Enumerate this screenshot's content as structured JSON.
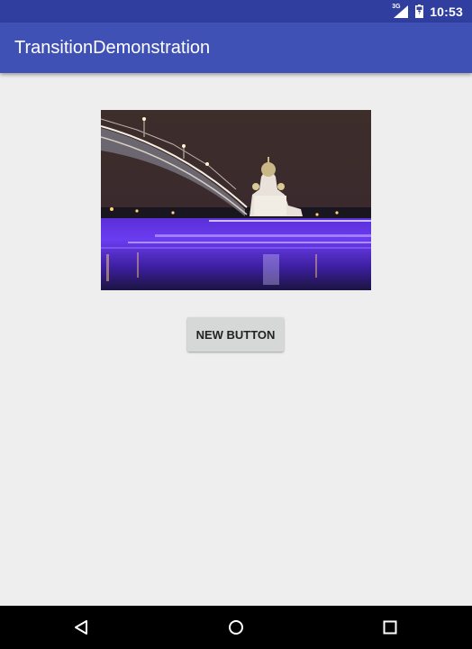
{
  "status_bar": {
    "network_type": "3G",
    "signal_icon": "cell-signal-icon",
    "battery_icon": "battery-icon",
    "time": "10:53",
    "background_color": "#303f9f"
  },
  "app_bar": {
    "title": "TransitionDemonstration",
    "background_color": "#3f51b5"
  },
  "main": {
    "image": {
      "description_icon": "photo-night-bridge-cathedral"
    },
    "button": {
      "label": "NEW BUTTON"
    }
  },
  "nav_bar": {
    "back_icon": "back-triangle-icon",
    "home_icon": "home-circle-icon",
    "recents_icon": "recents-square-icon"
  }
}
